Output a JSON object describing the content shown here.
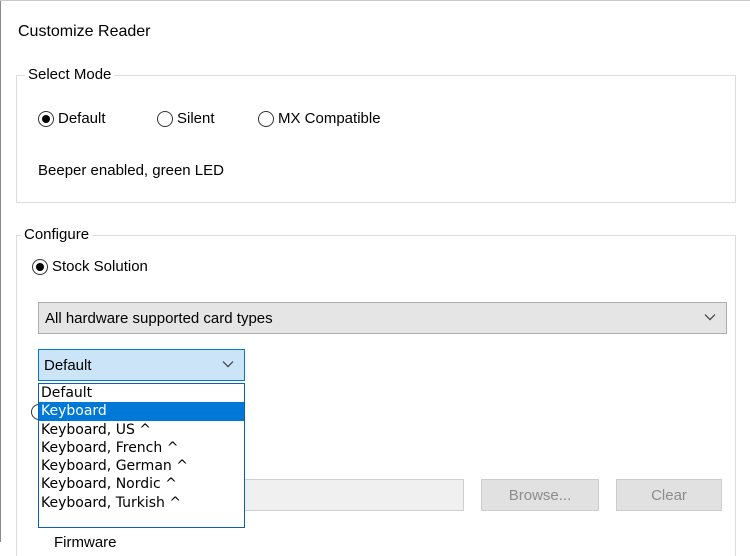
{
  "window": {
    "title": "Customize Reader"
  },
  "select_mode": {
    "label": "Select Mode",
    "options": [
      {
        "label": "Default",
        "checked": true
      },
      {
        "label": "Silent",
        "checked": false
      },
      {
        "label": "MX Compatible",
        "checked": false
      }
    ],
    "description": "Beeper enabled, green LED"
  },
  "configure": {
    "label": "Configure",
    "stock_solution_label": "Stock Solution",
    "card_types_value": "All hardware supported card types",
    "keyboard_select": {
      "value": "Default",
      "options": [
        "Default",
        "Keyboard",
        "Keyboard, US ^",
        "Keyboard, French ^",
        "Keyboard, German ^",
        "Keyboard, Nordic ^",
        "Keyboard, Turkish ^"
      ],
      "highlighted": "Keyboard"
    },
    "browse_label": "Browse...",
    "clear_label": "Clear",
    "firmware_label": "Firmware"
  }
}
